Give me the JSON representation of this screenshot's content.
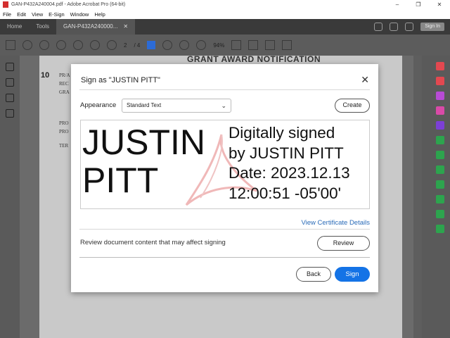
{
  "window": {
    "title": "GAN-P432A240004.pdf - Adobe Acrobat Pro (64-bit)",
    "controls": [
      "–",
      "❐",
      "✕"
    ]
  },
  "menu": [
    "File",
    "Edit",
    "View",
    "E-Sign",
    "Window",
    "Help"
  ],
  "tabs": {
    "home": "Home",
    "tools": "Tools",
    "document": "GAN-P432A240000...",
    "document_close": "✕",
    "signin": "Sign In"
  },
  "toolbar": {
    "page_current": "2",
    "page_total": "/ 4",
    "zoom": "94%"
  },
  "document": {
    "heading": "GRANT AWARD NOTIFICATION",
    "section_number": "10",
    "lines": [
      "PR/A",
      "REC",
      "GRA",
      "PRO",
      "PRO",
      "TER"
    ]
  },
  "dialog": {
    "title": "Sign as \"JUSTIN PITT\"",
    "close": "✕",
    "appearance_label": "Appearance",
    "appearance_value": "Standard Text",
    "create_label": "Create",
    "preview": {
      "name_line1": "JUSTIN",
      "name_line2": "PITT",
      "detail_line1": "Digitally signed",
      "detail_line2": "by JUSTIN PITT",
      "detail_line3": "Date: 2023.12.13",
      "detail_line4": "12:00:51 -05'00'"
    },
    "view_certificate_label": "View Certificate Details",
    "review_text": "Review document content that may affect signing",
    "review_label": "Review",
    "back_label": "Back",
    "sign_label": "Sign",
    "accent_color": "#1473e6"
  }
}
